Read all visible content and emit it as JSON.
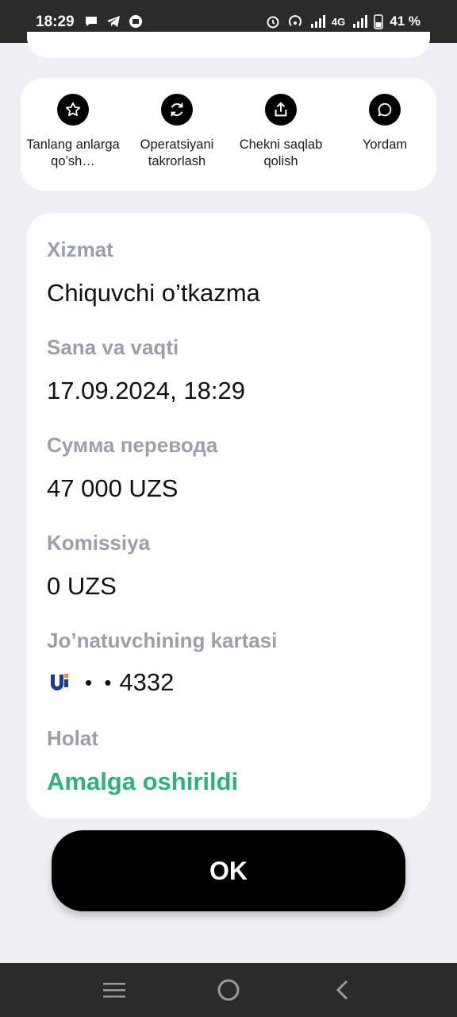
{
  "status_bar": {
    "time": "18:29",
    "network": "4G",
    "battery": "41 %",
    "left_icons": [
      "chat-icon",
      "telegram-icon",
      "app-icon"
    ],
    "right_icons": [
      "alarm-icon",
      "hotspot-icon",
      "signal-icon",
      "signal-icon",
      "battery-icon"
    ]
  },
  "actions": [
    {
      "icon": "star-icon",
      "label": "Tanlang anlarga qo’sh…"
    },
    {
      "icon": "repeat-icon",
      "label": "Operatsiyani takrorlash"
    },
    {
      "icon": "share-icon",
      "label": "Chekni saqlab qolish"
    },
    {
      "icon": "chat-bubble-icon",
      "label": "Yordam"
    }
  ],
  "details": {
    "service_label": "Xizmat",
    "service_value": "Chiquvchi o’tkazma",
    "datetime_label": "Sana va vaqti",
    "datetime_value": "17.09.2024, 18:29",
    "amount_label": "Сумма перевода",
    "amount_value": "47 000 UZS",
    "commission_label": "Komissiya",
    "commission_value": "0 UZS",
    "sender_card_label": "Jo’natuvchining kartasi",
    "sender_card_mask": "• •",
    "sender_card_number": "4332",
    "status_label": "Holat",
    "status_value": "Amalga oshirildi"
  },
  "ok_button": "OK",
  "colors": {
    "status_success": "#2fb27a",
    "label_gray": "#9aa0ab",
    "background": "#eef0f5"
  },
  "nav_bar": [
    "menu-icon",
    "home-icon",
    "back-icon"
  ]
}
